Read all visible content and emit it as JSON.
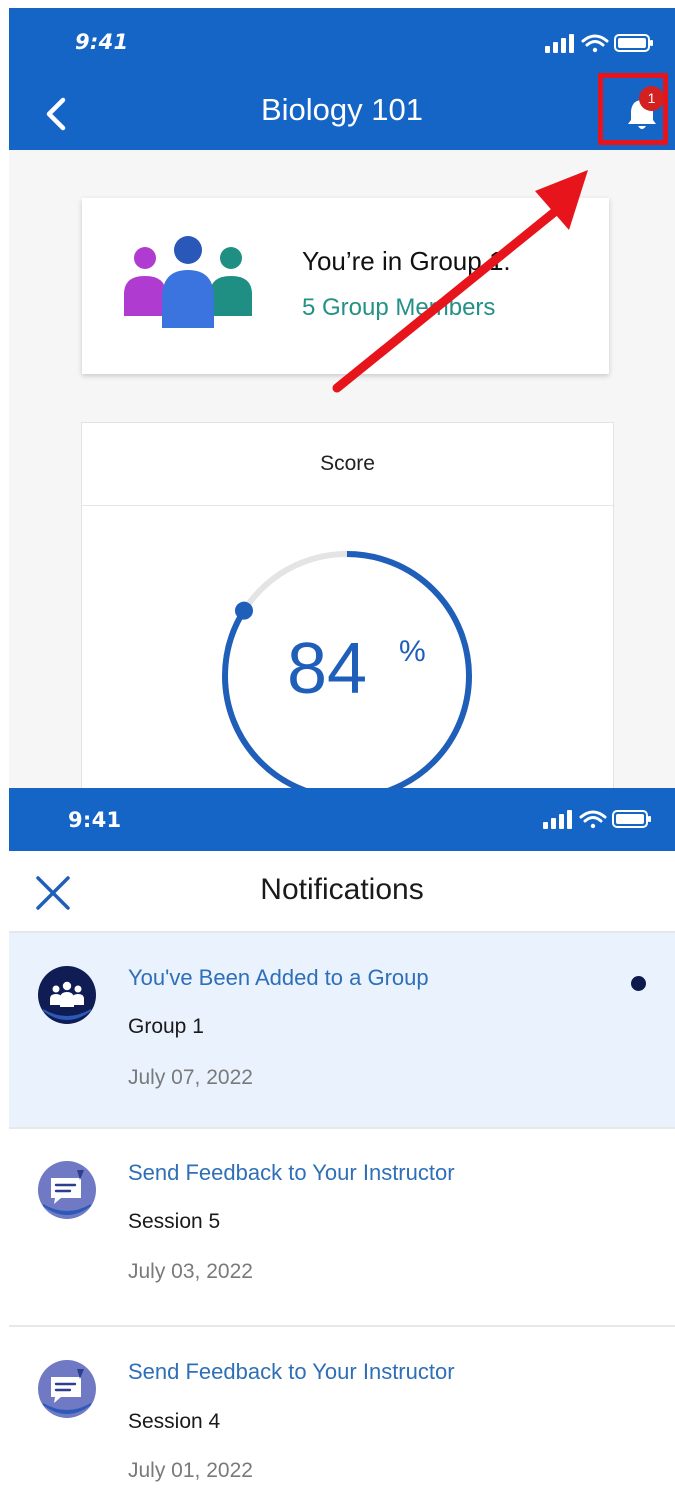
{
  "status_bar": {
    "time": "9:41"
  },
  "course": {
    "title": "Biology 101",
    "notification_badge": "1"
  },
  "group_card": {
    "title": "You’re in Group 1.",
    "members": "5 Group Members"
  },
  "score_card": {
    "header": "Score",
    "value": "84",
    "unit": "%",
    "progress_percent": 84
  },
  "notifications": {
    "title": "Notifications",
    "items": [
      {
        "heading": "You've Been Added to a Group",
        "subtitle": "Group 1",
        "date": "July 07, 2022",
        "unread": true,
        "icon": "group-icon"
      },
      {
        "heading": "Send Feedback to Your Instructor",
        "subtitle": "Session 5",
        "date": "July 03, 2022",
        "unread": false,
        "icon": "feedback-icon"
      },
      {
        "heading": "Send Feedback to Your Instructor",
        "subtitle": "Session 4",
        "date": "July 01, 2022",
        "unread": false,
        "icon": "feedback-icon"
      }
    ]
  },
  "colors": {
    "brand_blue": "#1565c7",
    "member_teal": "#249187",
    "badge_red": "#d32020",
    "annotation_red": "#e8141b",
    "unread_bg": "#eaf3fd",
    "link_blue": "#2e6fb8"
  }
}
